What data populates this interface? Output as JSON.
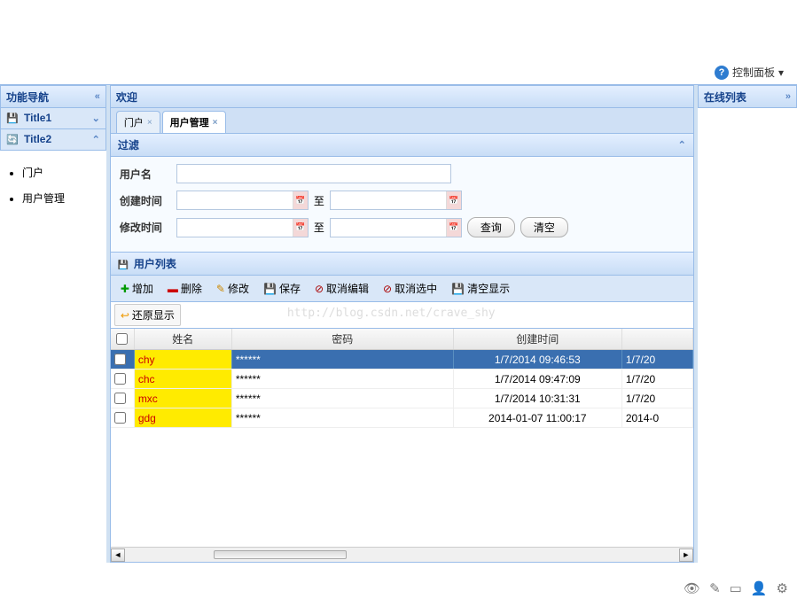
{
  "topbar": {
    "control_panel": "控制面板"
  },
  "sidebar": {
    "header": "功能导航",
    "title1": "Title1",
    "title2": "Title2",
    "nav": [
      "门户",
      "用户管理"
    ]
  },
  "right": {
    "header": "在线列表"
  },
  "main": {
    "header": "欢迎",
    "tabs": [
      {
        "label": "门户",
        "active": false
      },
      {
        "label": "用户管理",
        "active": true
      }
    ],
    "filter": {
      "title": "过滤",
      "username_label": "用户名",
      "create_label": "创建时间",
      "modify_label": "修改时间",
      "to": "至",
      "query": "查询",
      "clear": "清空"
    },
    "grid": {
      "title": "用户列表",
      "toolbar": {
        "add": "增加",
        "delete": "删除",
        "edit": "修改",
        "save": "保存",
        "cancel_edit": "取消编辑",
        "cancel_sel": "取消选中",
        "clear_display": "清空显示",
        "restore": "还原显示"
      },
      "columns": {
        "name": "姓名",
        "password": "密码",
        "create": "创建时间"
      },
      "rows": [
        {
          "name": "chy",
          "pwd": "******",
          "create": "1/7/2014 09:46:53",
          "mod": "1/7/20",
          "selected": true
        },
        {
          "name": "chc",
          "pwd": "******",
          "create": "1/7/2014 09:47:09",
          "mod": "1/7/20",
          "selected": false
        },
        {
          "name": "mxc",
          "pwd": "******",
          "create": "1/7/2014 10:31:31",
          "mod": "1/7/20",
          "selected": false
        },
        {
          "name": "gdg",
          "pwd": "******",
          "create": "2014-01-07 11:00:17",
          "mod": "2014-0",
          "selected": false
        }
      ]
    }
  },
  "watermark": "http://blog.csdn.net/crave_shy"
}
